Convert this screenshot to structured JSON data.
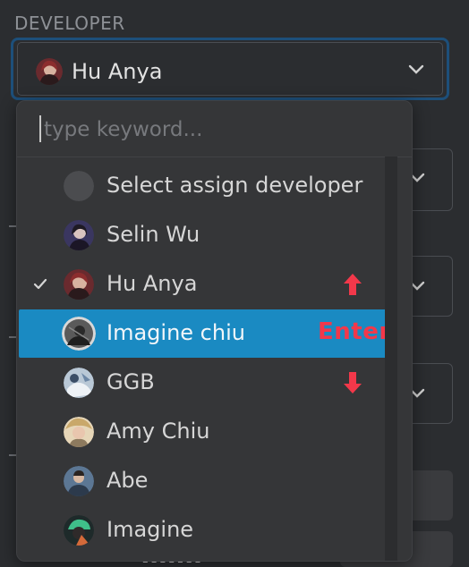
{
  "section": {
    "label": "DEVELOPER"
  },
  "selected": {
    "name": "Hu Anya",
    "avatar": "hu-anya-avatar"
  },
  "icons": {
    "chevron": "chevron-down-icon",
    "check": "check-icon",
    "arrow_up": "arrow-up-icon",
    "arrow_down": "arrow-down-icon"
  },
  "dropdown": {
    "search_placeholder": "type keyword...",
    "options": [
      {
        "label": "Select assign developer",
        "avatar": "placeholder-avatar"
      },
      {
        "label": "Selin Wu",
        "avatar": "selin-wu-avatar"
      },
      {
        "label": "Hu Anya",
        "avatar": "hu-anya-avatar",
        "checked": true
      },
      {
        "label": "Imagine chiu",
        "avatar": "imagine-chiu-avatar",
        "highlighted": true
      },
      {
        "label": "GGB",
        "avatar": "ggb-avatar"
      },
      {
        "label": "Amy Chiu",
        "avatar": "amy-chiu-avatar"
      },
      {
        "label": "Abe",
        "avatar": "abe-avatar"
      },
      {
        "label": "Imagine",
        "avatar": "imagine-avatar"
      }
    ]
  },
  "annotations": {
    "enter": "Enter"
  },
  "colors": {
    "background": "#2b2d30",
    "dropdown": "#353638",
    "highlight": "#1a8ac2",
    "focus_border": "#1d4f7a",
    "annotation": "#f2384a"
  }
}
